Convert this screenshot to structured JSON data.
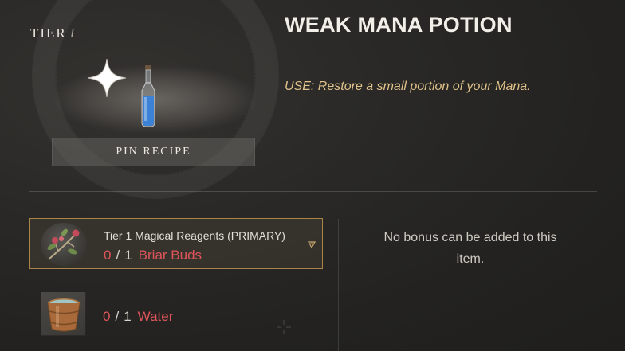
{
  "header": {
    "tier_word": "TIER",
    "tier_number": "I"
  },
  "item": {
    "title": "WEAK MANA POTION",
    "description": "USE: Restore a small portion of your Mana.",
    "icons": [
      "sparkle-icon",
      "mana-potion-icon"
    ],
    "potion_color": "#3b82d6"
  },
  "pin_button": {
    "label": "PIN RECIPE"
  },
  "reagents": [
    {
      "label": "Tier 1 Magical Reagents (PRIMARY)",
      "have": "0",
      "sep": "/",
      "need": "1",
      "name": "Briar Buds",
      "icon": "briar-buds-icon"
    },
    {
      "label": "",
      "have": "0",
      "sep": "/",
      "need": "1",
      "name": "Water",
      "icon": "water-bucket-icon"
    }
  ],
  "bonus": {
    "text": "No bonus can be added to this item."
  },
  "colors": {
    "accent_gold": "#a8864a",
    "missing_red": "#e0555a",
    "description_gold": "#e0c28a"
  }
}
